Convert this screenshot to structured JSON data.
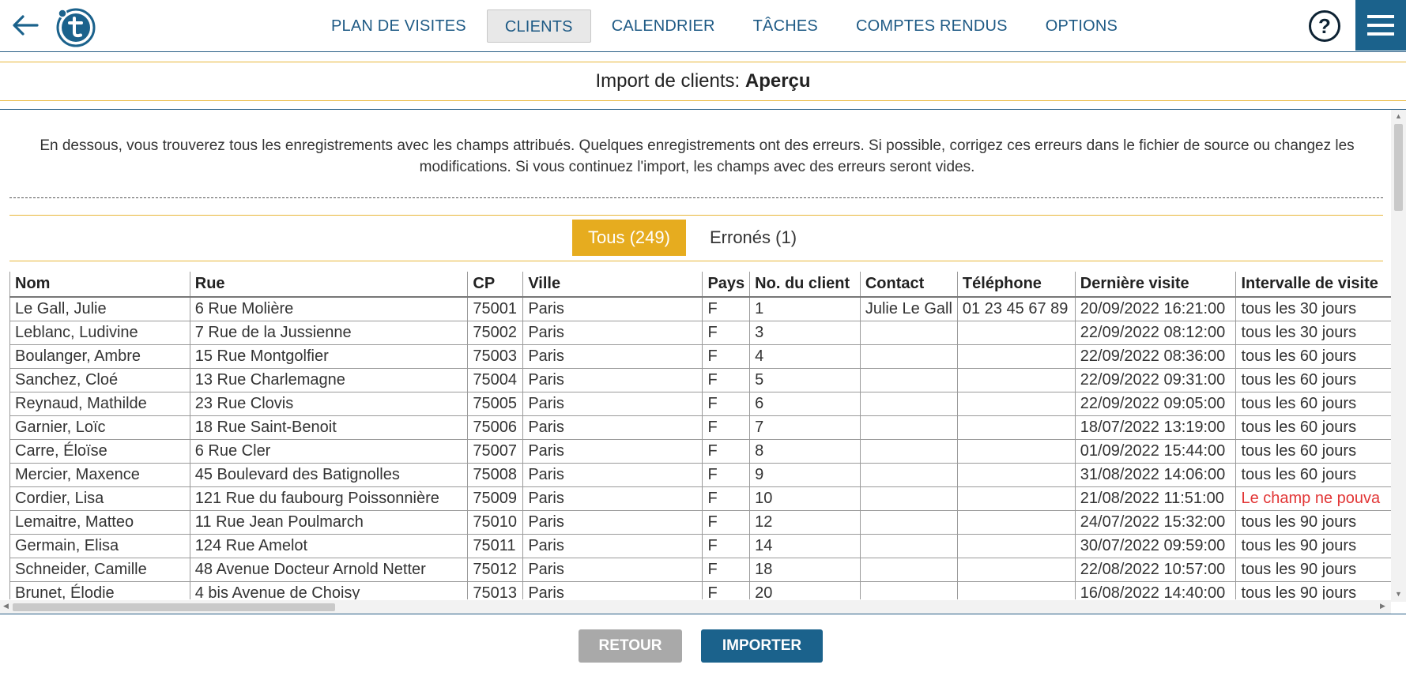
{
  "nav": {
    "items": [
      {
        "label": "PLAN DE VISITES",
        "active": false
      },
      {
        "label": "CLIENTS",
        "active": true
      },
      {
        "label": "CALENDRIER",
        "active": false
      },
      {
        "label": "TÂCHES",
        "active": false
      },
      {
        "label": "COMPTES RENDUS",
        "active": false
      },
      {
        "label": "OPTIONS",
        "active": false
      }
    ],
    "help_label": "?"
  },
  "title": {
    "prefix": "Import de clients:",
    "bold": "Aperçu"
  },
  "intro": "En dessous, vous trouverez tous les enregistrements avec les champs attribués. Quelques enregistrements ont des erreurs. Si possible, corrigez ces erreurs dans le fichier de source ou changez les modifications. Si vous continuez l'import, les champs avec des erreurs seront vides.",
  "tabs": {
    "all": "Tous (249)",
    "errors": "Erronés (1)"
  },
  "table": {
    "columns": [
      "Nom",
      "Rue",
      "CP",
      "Ville",
      "Pays",
      "No. du client",
      "Contact",
      "Téléphone",
      "Dernière visite",
      "Intervalle de visite"
    ],
    "rows": [
      {
        "cells": [
          "Le Gall, Julie",
          "6 Rue Molière",
          "75001",
          "Paris",
          "F",
          "1",
          "Julie Le Gall",
          "01 23 45 67 89",
          "20/09/2022 16:21:00",
          "tous les 30 jours"
        ],
        "error_col": -1
      },
      {
        "cells": [
          "Leblanc, Ludivine",
          "7 Rue de la Jussienne",
          "75002",
          "Paris",
          "F",
          "3",
          "",
          "",
          "22/09/2022 08:12:00",
          "tous les 30 jours"
        ],
        "error_col": -1
      },
      {
        "cells": [
          "Boulanger, Ambre",
          "15 Rue Montgolfier",
          "75003",
          "Paris",
          "F",
          "4",
          "",
          "",
          "22/09/2022 08:36:00",
          "tous les 60 jours"
        ],
        "error_col": -1
      },
      {
        "cells": [
          "Sanchez, Cloé",
          "13 Rue Charlemagne",
          "75004",
          "Paris",
          "F",
          "5",
          "",
          "",
          "22/09/2022 09:31:00",
          "tous les 60 jours"
        ],
        "error_col": -1
      },
      {
        "cells": [
          "Reynaud, Mathilde",
          "23 Rue Clovis",
          "75005",
          "Paris",
          "F",
          "6",
          "",
          "",
          "22/09/2022 09:05:00",
          "tous les 60 jours"
        ],
        "error_col": -1
      },
      {
        "cells": [
          "Garnier, Loïc",
          "18 Rue Saint-Benoit",
          "75006",
          "Paris",
          "F",
          "7",
          "",
          "",
          "18/07/2022 13:19:00",
          "tous les 60 jours"
        ],
        "error_col": -1
      },
      {
        "cells": [
          "Carre, Éloïse",
          "6 Rue Cler",
          "75007",
          "Paris",
          "F",
          "8",
          "",
          "",
          "01/09/2022 15:44:00",
          "tous les 60 jours"
        ],
        "error_col": -1
      },
      {
        "cells": [
          "Mercier, Maxence",
          "45 Boulevard des Batignolles",
          "75008",
          "Paris",
          "F",
          "9",
          "",
          "",
          "31/08/2022 14:06:00",
          "tous les 60 jours"
        ],
        "error_col": -1
      },
      {
        "cells": [
          "Cordier, Lisa",
          "121 Rue du faubourg Poissonnière",
          "75009",
          "Paris",
          "F",
          "10",
          "",
          "",
          "21/08/2022 11:51:00",
          "Le champ ne pouva"
        ],
        "error_col": 9
      },
      {
        "cells": [
          "Lemaitre, Matteo",
          "11 Rue Jean Poulmarch",
          "75010",
          "Paris",
          "F",
          "12",
          "",
          "",
          "24/07/2022 15:32:00",
          "tous les 90 jours"
        ],
        "error_col": -1
      },
      {
        "cells": [
          "Germain, Elisa",
          "124 Rue Amelot",
          "75011",
          "Paris",
          "F",
          "14",
          "",
          "",
          "30/07/2022 09:59:00",
          "tous les 90 jours"
        ],
        "error_col": -1
      },
      {
        "cells": [
          "Schneider, Camille",
          "48 Avenue Docteur Arnold Netter",
          "75012",
          "Paris",
          "F",
          "18",
          "",
          "",
          "22/08/2022 10:57:00",
          "tous les 90 jours"
        ],
        "error_col": -1
      },
      {
        "cells": [
          "Brunet, Élodie",
          "4 bis Avenue de Choisy",
          "75013",
          "Paris",
          "F",
          "20",
          "",
          "",
          "16/08/2022 14:40:00",
          "tous les 90 jours"
        ],
        "error_col": -1
      }
    ]
  },
  "buttons": {
    "back": "RETOUR",
    "import": "IMPORTER"
  },
  "colors": {
    "accent": "#e6ac1f",
    "primary": "#1b628c",
    "error": "#e23636",
    "disabled": "#a9a9a9"
  }
}
